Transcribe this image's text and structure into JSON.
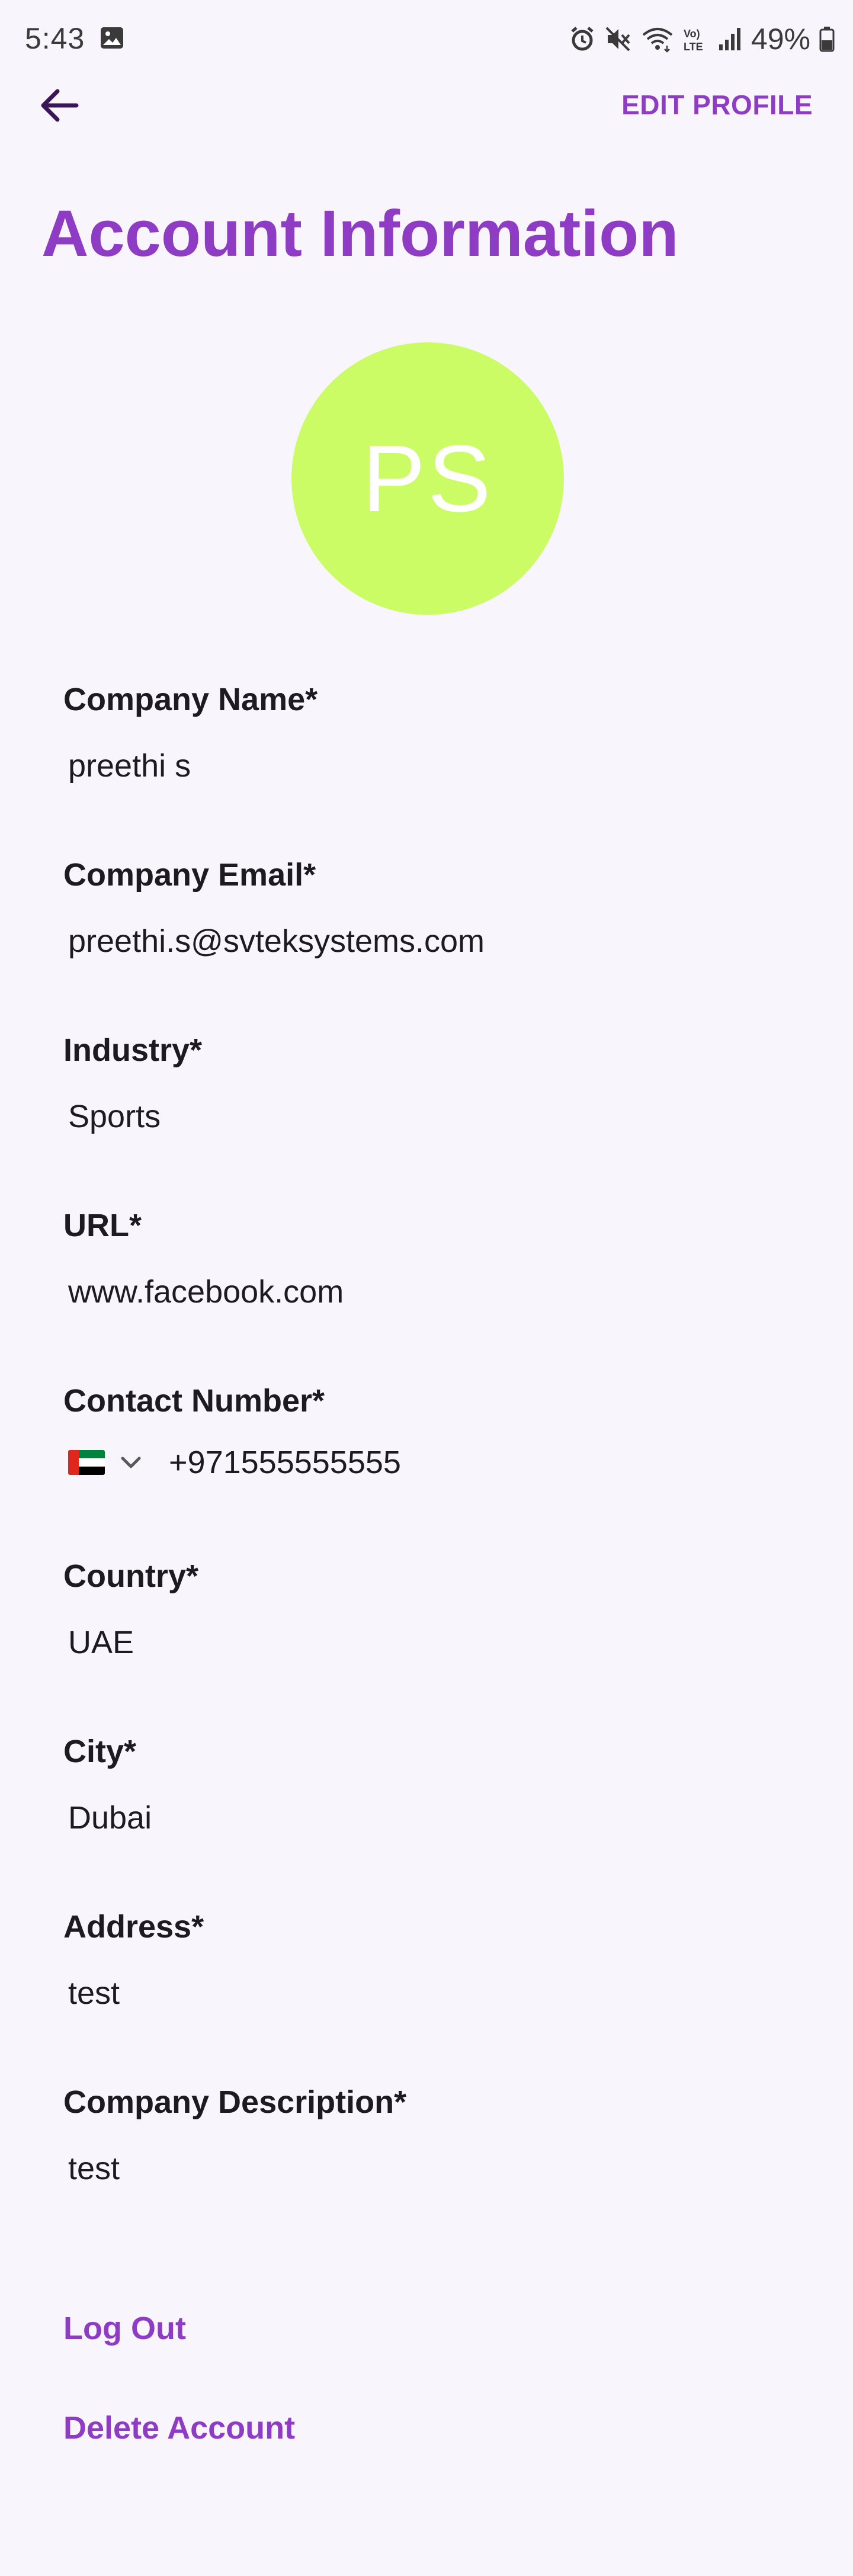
{
  "status_bar": {
    "time": "5:43",
    "battery": "49%",
    "icons": [
      "gallery-icon",
      "alarm-icon",
      "mute-icon",
      "wifi-icon",
      "volte-icon",
      "signal-icon",
      "battery-icon"
    ]
  },
  "app_bar": {
    "back_icon": "arrow-left-icon",
    "edit_label": "EDIT PROFILE"
  },
  "page": {
    "title": "Account Information"
  },
  "avatar": {
    "initials": "PS",
    "color": "#ccfc65"
  },
  "fields": [
    {
      "label": "Company Name*",
      "value": "preethi s"
    },
    {
      "label": "Company Email*",
      "value": "preethi.s@svteksystems.com"
    },
    {
      "label": "Industry*",
      "value": "Sports"
    },
    {
      "label": "URL*",
      "value": "www.facebook.com"
    },
    {
      "label": "Contact Number*",
      "value": "+971555555555",
      "flag_icon": "uae-flag-icon"
    },
    {
      "label": "Country*",
      "value": "UAE"
    },
    {
      "label": "City*",
      "value": "Dubai"
    },
    {
      "label": "Address*",
      "value": "test"
    },
    {
      "label": "Company Description*",
      "value": "test"
    }
  ],
  "actions": {
    "logout": "Log Out",
    "delete": "Delete Account"
  },
  "colors": {
    "accent": "#8e3cc4",
    "background": "#f9f5fd",
    "text": "#1c1b1f"
  }
}
